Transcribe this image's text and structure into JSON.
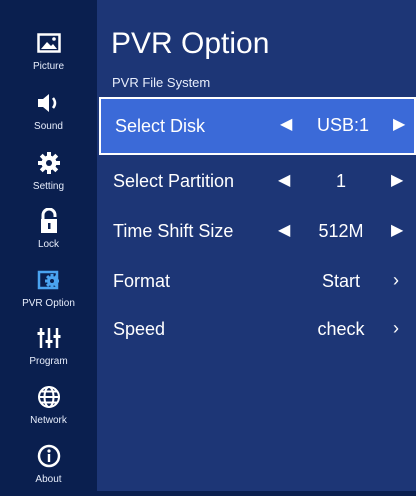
{
  "sidebar": {
    "items": [
      {
        "label": "Picture",
        "icon": "picture-icon"
      },
      {
        "label": "Sound",
        "icon": "speaker-icon"
      },
      {
        "label": "Setting",
        "icon": "gear-icon"
      },
      {
        "label": "Lock",
        "icon": "lock-icon"
      },
      {
        "label": "PVR Option",
        "icon": "pvr-gear-icon",
        "active": true
      },
      {
        "label": "Program",
        "icon": "sliders-icon"
      },
      {
        "label": "Network",
        "icon": "globe-icon"
      },
      {
        "label": "About",
        "icon": "info-icon"
      }
    ]
  },
  "main": {
    "title": "PVR Option",
    "subtitle": "PVR File System",
    "rows": [
      {
        "label": "Select Disk",
        "value": "USB:1",
        "left_arrow": "◀",
        "right_arrow": "▶",
        "selected": true
      },
      {
        "label": "Select Partition",
        "value": "1",
        "left_arrow": "◀",
        "right_arrow": "▶"
      },
      {
        "label": "Time Shift Size",
        "value": "512M",
        "left_arrow": "◀",
        "right_arrow": "▶"
      },
      {
        "label": "Format",
        "value": "Start",
        "chevron": "›"
      },
      {
        "label": "Speed",
        "value": "check",
        "chevron": "›"
      }
    ]
  },
  "colors": {
    "sidebar_bg": "#0a1f4f",
    "panel_bg": "#1d3676",
    "selected_bg": "#3b6ad8",
    "active_icon": "#4aa3f0"
  }
}
